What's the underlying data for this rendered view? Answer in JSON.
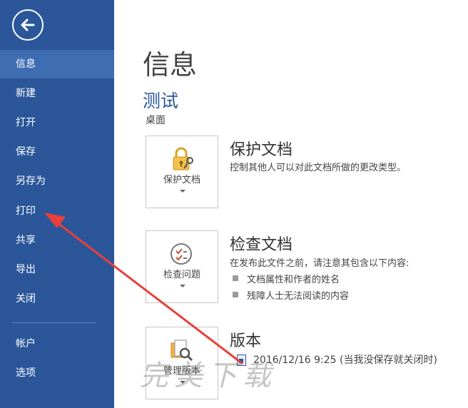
{
  "sidebar": {
    "items": [
      {
        "label": "信息"
      },
      {
        "label": "新建"
      },
      {
        "label": "打开"
      },
      {
        "label": "保存"
      },
      {
        "label": "另存为"
      },
      {
        "label": "打印"
      },
      {
        "label": "共享"
      },
      {
        "label": "导出"
      },
      {
        "label": "关闭"
      },
      {
        "label": "帐户"
      },
      {
        "label": "选项"
      }
    ],
    "active_index": 0
  },
  "main": {
    "title": "信息",
    "document_name": "测试",
    "document_location": "桌面",
    "protect": {
      "tile_label": "保护文档",
      "title": "保护文档",
      "description": "控制其他人可以对此文档所做的更改类型。"
    },
    "inspect": {
      "tile_label": "检查问题",
      "title": "检查文档",
      "description": "在发布此文件之前，请注意其包含以下内容:",
      "bullets": [
        "文档属性和作者的姓名",
        "残障人士无法阅读的内容"
      ]
    },
    "versions": {
      "tile_label": "管理版本",
      "title": "版本",
      "entry": "2016/12/16 9:25 (当我没保存就关闭时)"
    }
  },
  "watermark": "完美下载",
  "colors": {
    "sidebar_bg": "#2b579a",
    "sidebar_active": "#3f6db2",
    "accent": "#2b579a",
    "annotation_arrow": "#e8403a"
  }
}
